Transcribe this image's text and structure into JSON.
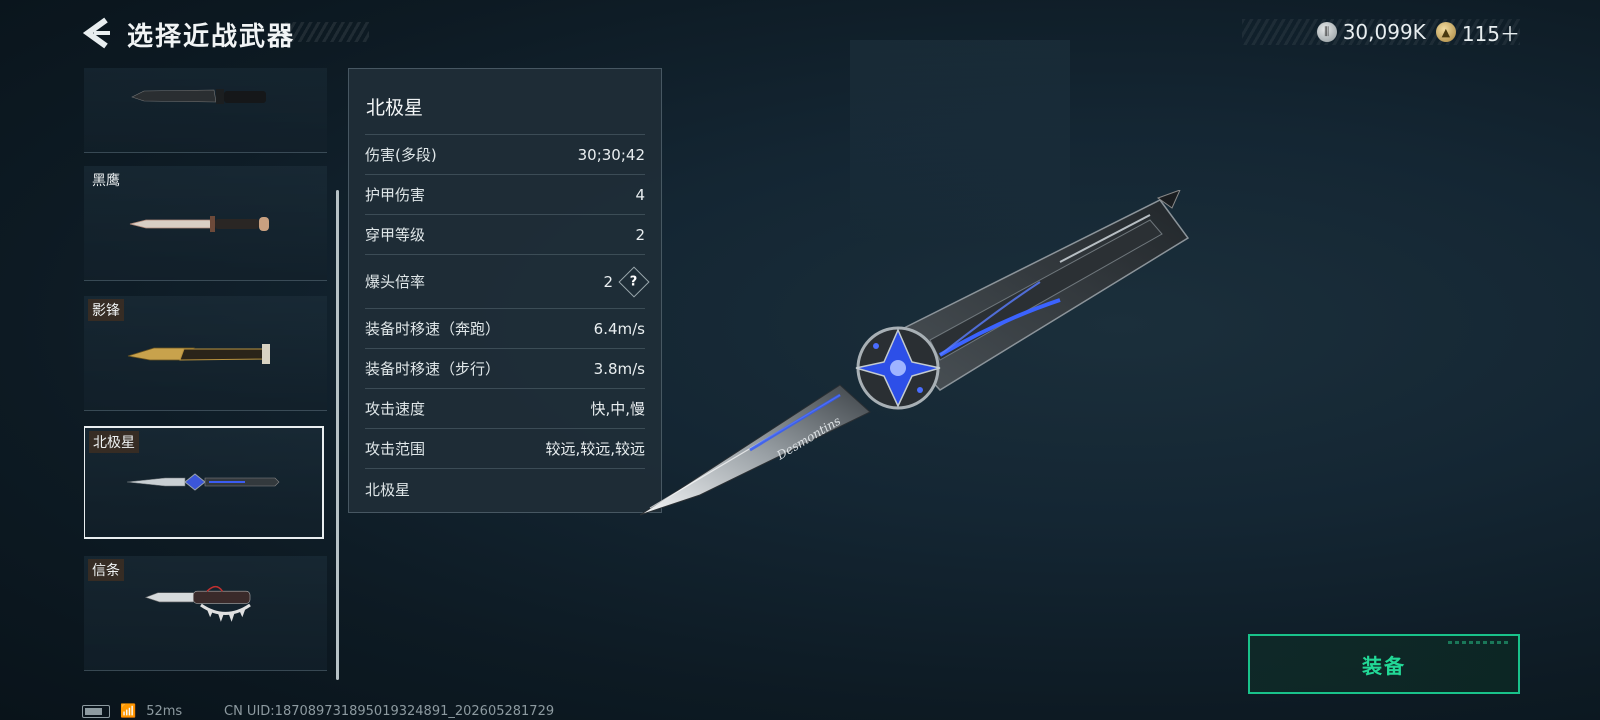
{
  "header": {
    "title": "选择近战武器"
  },
  "currency": {
    "silver": "30,099K",
    "gold": "115＋"
  },
  "weapon_list": [
    {
      "name": "",
      "selected": false
    },
    {
      "name": "黑鹰",
      "selected": false
    },
    {
      "name": "影锋",
      "selected": false
    },
    {
      "name": "北极星",
      "selected": true
    },
    {
      "name": "信条",
      "selected": false
    }
  ],
  "stats": {
    "title": "北极星",
    "rows": [
      {
        "label": "伤害(多段)",
        "value": "30;30;42"
      },
      {
        "label": "护甲伤害",
        "value": "4"
      },
      {
        "label": "穿甲等级",
        "value": "2"
      },
      {
        "label": "爆头倍率",
        "value": "2"
      },
      {
        "label": "装备时移速（奔跑）",
        "value": "6.4m/s"
      },
      {
        "label": "装备时移速（步行）",
        "value": "3.8m/s"
      },
      {
        "label": "攻击速度",
        "value": "快,中,慢"
      },
      {
        "label": "攻击范围",
        "value": "较远,较远,较远"
      }
    ],
    "footer_name": "北极星",
    "help_symbol": "?"
  },
  "weapon_engraving": "Desmontins",
  "equip_button": {
    "label": "装备"
  },
  "status": {
    "ping": "52ms",
    "uid": "CN UID:187089731895019324891_202605281729"
  },
  "colors": {
    "accent": "#22d896",
    "background": "#0d1a23"
  }
}
